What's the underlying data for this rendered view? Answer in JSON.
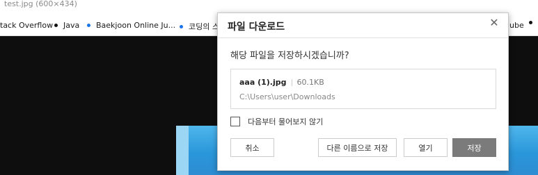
{
  "window": {
    "tab_title": "test.jpg (600×434)"
  },
  "bookmarks": [
    {
      "label": "tack Overflow",
      "dot_color": ""
    },
    {
      "label": "Java",
      "dot_color": "#111111"
    },
    {
      "label": "Baekjoon Online Ju...",
      "dot_color": "#1a73e8"
    },
    {
      "label": "코딩의 스",
      "dot_color": "#1a73e8"
    },
    {
      "label": "ube",
      "dot_color": ""
    }
  ],
  "bookmark_trailing_dot_color": "#111111",
  "dialog": {
    "title": "파일 다운로드",
    "close_icon": "close-icon",
    "question": "해당 파일을 저장하시겠습니까?",
    "file": {
      "name": "aaa (1).jpg",
      "size": "60.1KB",
      "path": "C:\\Users\\user\\Downloads"
    },
    "dont_ask_label": "다음부터 물어보지 않기",
    "dont_ask_checked": false,
    "buttons": {
      "cancel": "취소",
      "save_as": "다른 이름으로 저장",
      "open": "열기",
      "save": "저장"
    }
  },
  "colors": {
    "primary_button": "#7b7b7b",
    "viewer_background": "#0e0e0e"
  }
}
